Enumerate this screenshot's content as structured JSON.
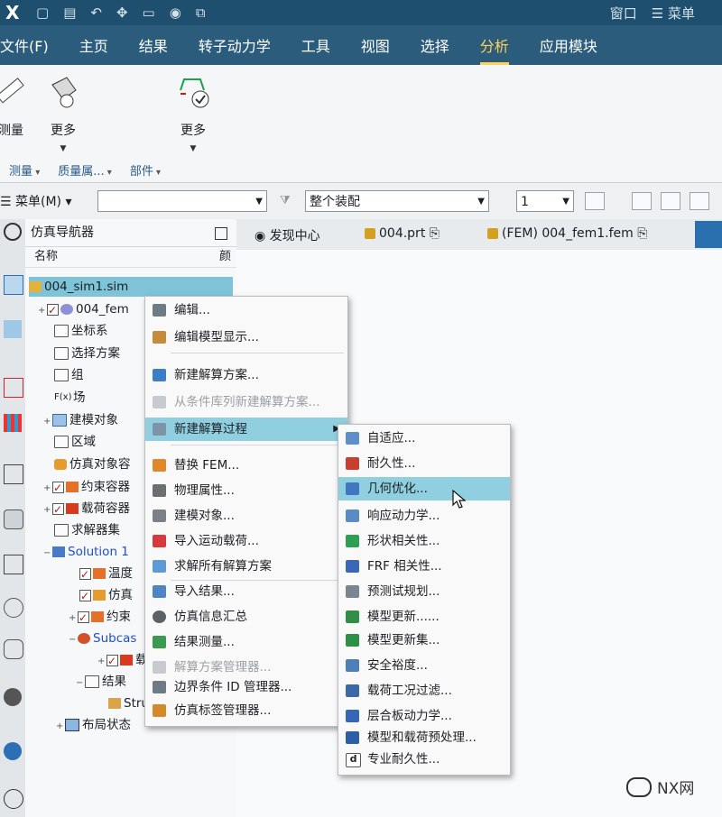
{
  "quick_access": {
    "logo": "X",
    "window_label": "窗口",
    "menu_label": "☰ 菜单"
  },
  "menubar": {
    "items": [
      "文件(F)",
      "主页",
      "结果",
      "转子动力学",
      "工具",
      "视图",
      "选择",
      "分析",
      "应用模块"
    ],
    "active": "分析"
  },
  "ribbon": {
    "measure_label": "测量",
    "more1_label": "更多",
    "more2_label": "更多",
    "groups": [
      "测量",
      "质量属...",
      "部件"
    ]
  },
  "selection_bar": {
    "menu_label": "☰ 菜单(M) ▾",
    "filter_value": "",
    "assembly_value": "整个装配",
    "level_value": "1"
  },
  "navigator": {
    "title": "仿真导航器",
    "col_name": "名称",
    "col_other": "颜",
    "rows": [
      {
        "label": "004_sim1.sim"
      },
      {
        "label": "004_fem"
      },
      {
        "label": "坐标系"
      },
      {
        "label": "选择方案"
      },
      {
        "label": "组"
      },
      {
        "label": "场"
      },
      {
        "label": "建模对象"
      },
      {
        "label": "区域"
      },
      {
        "label": "仿真对象容"
      },
      {
        "label": "约束容器"
      },
      {
        "label": "载荷容器"
      },
      {
        "label": "求解器集"
      },
      {
        "label": "Solution 1"
      },
      {
        "label": "温度"
      },
      {
        "label": "仿真"
      },
      {
        "label": "约束"
      },
      {
        "label": "Subcas"
      },
      {
        "label": "载"
      },
      {
        "label": "结果"
      },
      {
        "label": "Stru"
      },
      {
        "label": "布局状态"
      }
    ]
  },
  "tabs": [
    {
      "label": "发现中心"
    },
    {
      "label": "004.prt"
    },
    {
      "label": "(FEM) 004_fem1.fem"
    }
  ],
  "context_menu": {
    "items": [
      {
        "label": "编辑..."
      },
      {
        "label": "编辑模型显示..."
      },
      {
        "label": "新建解算方案..."
      },
      {
        "label": "从条件库列新建解算方案..."
      },
      {
        "label": "新建解算过程"
      },
      {
        "label": "替换 FEM..."
      },
      {
        "label": "物理属性..."
      },
      {
        "label": "建模对象..."
      },
      {
        "label": "导入运动载荷..."
      },
      {
        "label": "求解所有解算方案"
      },
      {
        "label": "导入结果..."
      },
      {
        "label": "仿真信息汇总"
      },
      {
        "label": "结果测量..."
      },
      {
        "label": "解算方案管理器..."
      },
      {
        "label": "边界条件 ID 管理器..."
      },
      {
        "label": "仿真标签管理器..."
      }
    ]
  },
  "submenu": {
    "items": [
      {
        "label": "自适应..."
      },
      {
        "label": "耐久性..."
      },
      {
        "label": "几何优化..."
      },
      {
        "label": "响应动力学..."
      },
      {
        "label": "形状相关性..."
      },
      {
        "label": "FRF 相关性..."
      },
      {
        "label": "预测试规划..."
      },
      {
        "label": "模型更新......"
      },
      {
        "label": "模型更新集..."
      },
      {
        "label": "安全裕度..."
      },
      {
        "label": "载荷工况过滤..."
      },
      {
        "label": "层合板动力学..."
      },
      {
        "label": "模型和载荷预处理..."
      },
      {
        "label": "专业耐久性..."
      }
    ]
  },
  "watermark": "NX网",
  "colors": {
    "menubar": "#2b5c7c",
    "active_tab": "#ffd35a",
    "highlight": "#8fcfdf",
    "selected_row": "#7fc3d9"
  }
}
